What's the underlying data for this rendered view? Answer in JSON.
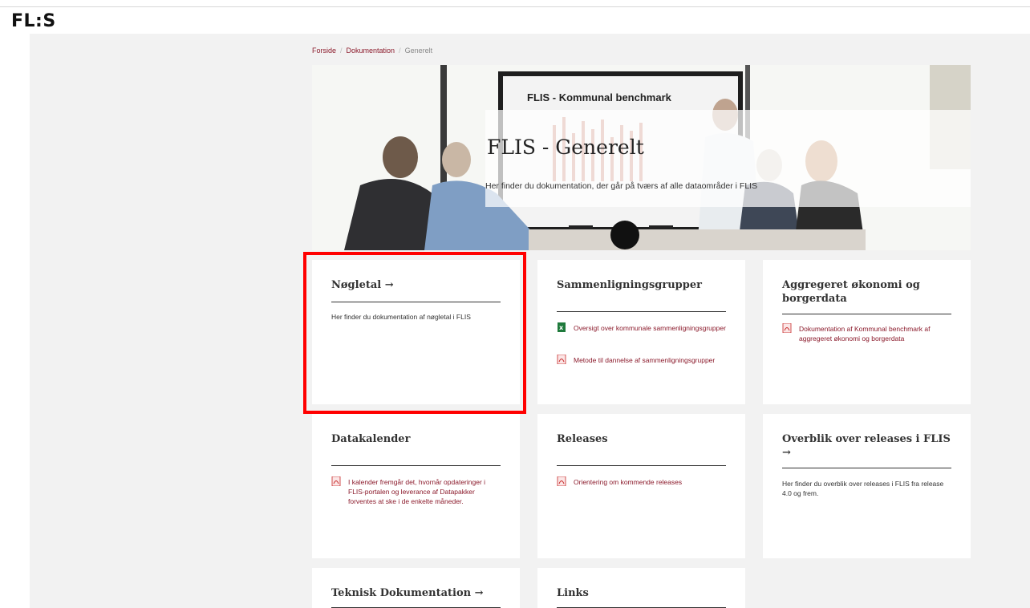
{
  "header": {
    "logo_text_a": "FL",
    "logo_colon": ":",
    "logo_text_b": "S"
  },
  "breadcrumb": {
    "items": [
      "Forside",
      "Dokumentation"
    ],
    "separator": "/",
    "current": "Generelt"
  },
  "hero": {
    "title": "FLIS - Generelt",
    "subtitle": "Her finder du dokumentation, der går på tværs af alle dataområder i FLIS",
    "screen_title": "FLIS - Kommunal benchmark"
  },
  "cards": {
    "noegletal": {
      "title": "Nøgletal →",
      "text": "Her finder du dokumentation af nøgletal i FLIS"
    },
    "sammen": {
      "title": "Sammenligningsgrupper",
      "links": [
        {
          "label": "Oversigt over kommunale sammenligningsgrupper",
          "icon": "excel-icon"
        },
        {
          "label": "Metode til dannelse af sammenligningsgrupper",
          "icon": "pdf-icon"
        }
      ]
    },
    "aggregeret": {
      "title": "Aggregeret økonomi og borgerdata",
      "links": [
        {
          "label": "Dokumentation af Kommunal benchmark af aggregeret økonomi og borgerdata",
          "icon": "pdf-icon"
        }
      ]
    },
    "datakalender": {
      "title": "Datakalender",
      "links": [
        {
          "label": "I kalender fremgår det, hvornår opdateringer i FLIS-portalen og leverance af Datapakker forventes at ske i de enkelte måneder.",
          "icon": "pdf-icon"
        }
      ]
    },
    "releases": {
      "title": "Releases",
      "links": [
        {
          "label": "Orientering om kommende releases",
          "icon": "pdf-icon"
        }
      ]
    },
    "overblik": {
      "title": "Overblik over releases i FLIS →",
      "text": "Her finder du overblik over releases i FLIS fra release 4.0 og frem."
    },
    "teknisk": {
      "title": "Teknisk Dokumentation →"
    },
    "links": {
      "title": "Links"
    }
  },
  "colors": {
    "accent": "#8b1a2b",
    "page_bg": "#f2f2f2",
    "highlight": "#ff0000"
  }
}
